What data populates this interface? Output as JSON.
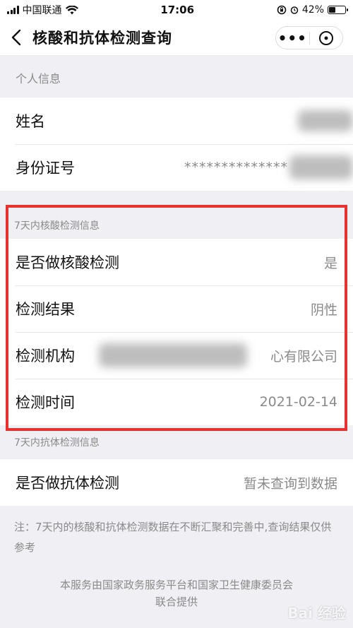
{
  "status_bar": {
    "carrier": "中国联通",
    "time": "17:06",
    "battery_pct": "42%"
  },
  "nav": {
    "title": "核酸和抗体检测查询",
    "more_label": "•••"
  },
  "personal": {
    "header": "个人信息",
    "rows": [
      {
        "label": "姓名",
        "value": ""
      },
      {
        "label": "身份证号",
        "value": "**************"
      }
    ]
  },
  "nucleic": {
    "header": "7天内核酸检测信息",
    "rows": [
      {
        "label": "是否做核酸检测",
        "value": "是"
      },
      {
        "label": "检测结果",
        "value": "阴性"
      },
      {
        "label": "检测机构",
        "value": "心有限公司"
      },
      {
        "label": "检测时间",
        "value": "2021-02-14"
      }
    ]
  },
  "antibody": {
    "header": "7天内抗体检测信息",
    "rows": [
      {
        "label": "是否做抗体检测",
        "value": "暂未查询到数据"
      }
    ]
  },
  "note": "注：7天内的核酸和抗体检测数据在不断汇聚和完善中,查询结果仅供参考",
  "footer": {
    "line1": "本服务由国家政务服务平台和国家卫生健康委员会",
    "line2": "联合提供"
  },
  "watermark": "Bai 经验",
  "colors": {
    "highlight": "#e83230",
    "background": "#efeff4"
  }
}
